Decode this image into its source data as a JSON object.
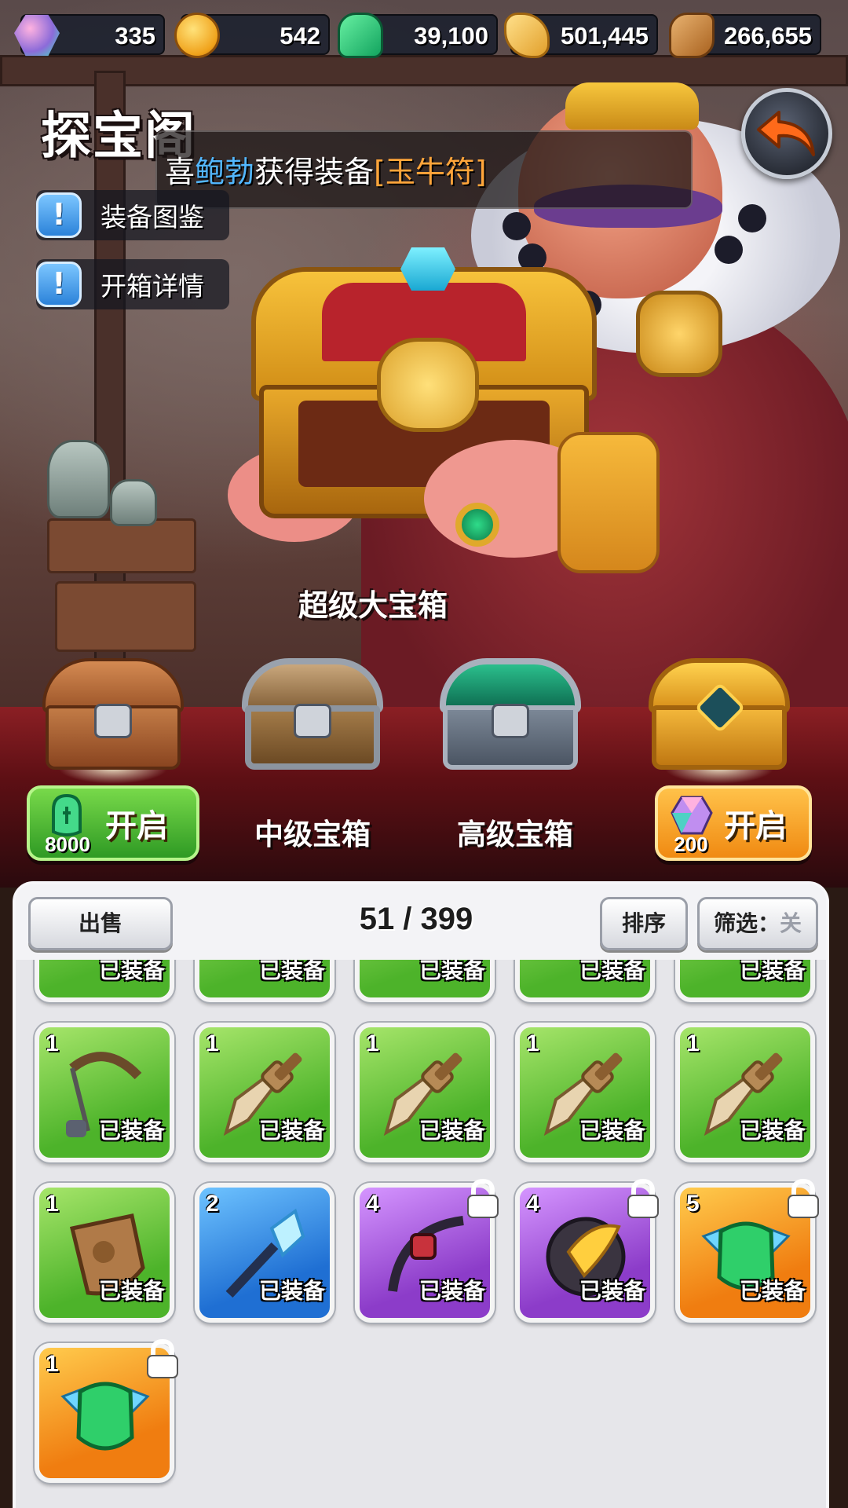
{
  "resources": [
    {
      "icon": "gem-icon",
      "value": "335"
    },
    {
      "icon": "coin-icon",
      "value": "542"
    },
    {
      "icon": "jade-icon",
      "value": "39,100"
    },
    {
      "icon": "wheat-icon",
      "value": "501,445"
    },
    {
      "icon": "wood-icon",
      "value": "266,655"
    }
  ],
  "header": {
    "title": "探宝阁"
  },
  "ticker": {
    "prefix": "喜",
    "player": "鲍勃",
    "middle": "获得装备",
    "item": "[玉牛符]"
  },
  "side_buttons": [
    {
      "label": "装备图鉴"
    },
    {
      "label": "开箱详情"
    }
  ],
  "featured_chest": {
    "name": "超级大宝箱"
  },
  "chest_row": {
    "open_green": {
      "cost": "8000",
      "label": "开启",
      "currency_icon": "jade-icon"
    },
    "mid_label": "中级宝箱",
    "high_label": "高级宝箱",
    "open_orange": {
      "cost": "200",
      "label": "开启",
      "currency_icon": "gem-icon"
    }
  },
  "inventory": {
    "sell_label": "出售",
    "count": "51 / 399",
    "sort_label": "排序",
    "filter_label": "筛选：",
    "filter_value": "关",
    "equipped_text": "已装备",
    "top_row_equipped": [
      "已装备",
      "已装备",
      "已装备",
      "已装备",
      "已装备"
    ],
    "rows": [
      [
        {
          "level": "1",
          "rarity": "green",
          "item_icon": "bow-icon",
          "equipped": "已装备"
        },
        {
          "level": "1",
          "rarity": "green",
          "item_icon": "sword-icon",
          "equipped": "已装备"
        },
        {
          "level": "1",
          "rarity": "green",
          "item_icon": "sword-icon",
          "equipped": "已装备"
        },
        {
          "level": "1",
          "rarity": "green",
          "item_icon": "sword-icon",
          "equipped": "已装备"
        },
        {
          "level": "1",
          "rarity": "green",
          "item_icon": "sword-icon",
          "equipped": "已装备"
        }
      ],
      [
        {
          "level": "1",
          "rarity": "green",
          "item_icon": "wooden-shield-icon",
          "equipped": "已装备"
        },
        {
          "level": "2",
          "rarity": "blue",
          "item_icon": "crystal-staff-icon",
          "equipped": "已装备",
          "locked": false
        },
        {
          "level": "4",
          "rarity": "purple",
          "item_icon": "dark-bow-icon",
          "equipped": "已装备",
          "locked": true
        },
        {
          "level": "4",
          "rarity": "purple",
          "item_icon": "golden-shield-icon",
          "equipped": "已装备",
          "locked": true
        },
        {
          "level": "5",
          "rarity": "orange",
          "item_icon": "jade-ox-talisman-icon",
          "equipped": "已装备",
          "locked": true
        }
      ],
      [
        {
          "level": "1",
          "rarity": "orange",
          "item_icon": "jade-ox-talisman-icon",
          "equipped": "",
          "locked": true
        }
      ]
    ]
  },
  "colors": {
    "green_rarity": "#4db32a",
    "blue_rarity": "#1f6fd3",
    "purple_rarity": "#8c3cc9",
    "orange_rarity": "#f07d10",
    "player_name": "#52b7ff",
    "item_name": "#ffa53a"
  }
}
